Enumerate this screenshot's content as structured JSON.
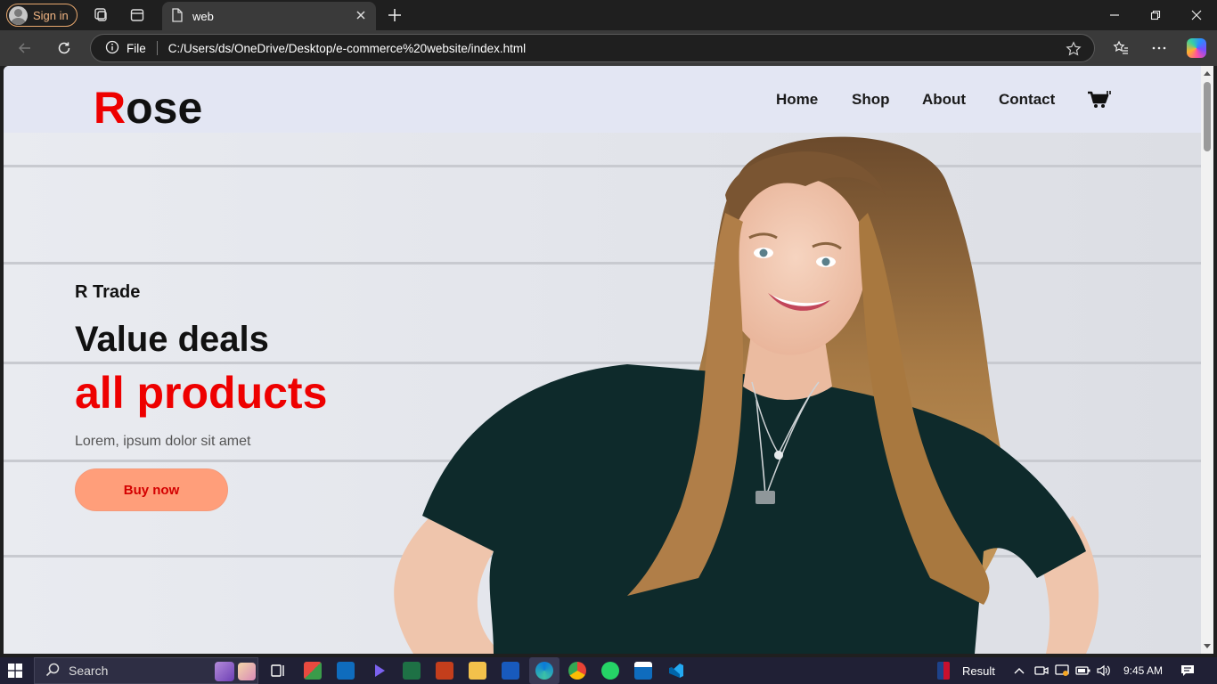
{
  "browser": {
    "signin_label": "Sign in",
    "tab_title": "web",
    "address_scheme_label": "File",
    "address_url": "C:/Users/ds/OneDrive/Desktop/e-commerce%20website/index.html"
  },
  "site": {
    "logo_first": "R",
    "logo_rest": "ose",
    "nav": [
      {
        "label": "Home"
      },
      {
        "label": "Shop"
      },
      {
        "label": "About"
      },
      {
        "label": "Contact"
      }
    ],
    "cart_icon": "cart-icon",
    "hero": {
      "eyebrow": "R Trade",
      "headline": "Value deals",
      "highlight": "all products",
      "subtext": "Lorem, ipsum dolor sit amet",
      "cta_label": "Buy now"
    },
    "colors": {
      "accent_red": "#ee0000",
      "header_bg": "#e3e6f3",
      "cta_bg": "#ff9e7a"
    }
  },
  "taskbar": {
    "search_label": "Search",
    "result_label": "Result",
    "time": "9:45 AM"
  }
}
